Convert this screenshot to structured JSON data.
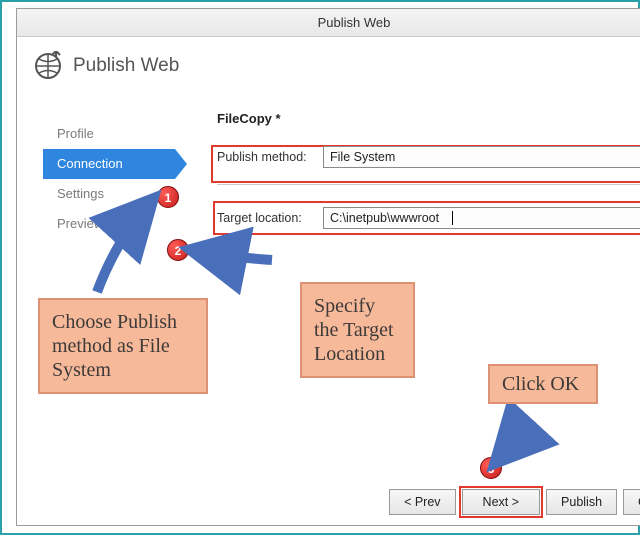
{
  "titlebar": {
    "title": "Publish Web",
    "help": "?"
  },
  "header": {
    "title": "Publish Web"
  },
  "sidebar": {
    "steps": [
      "Profile",
      "Connection",
      "Settings",
      "Preview"
    ],
    "active_index": 1
  },
  "main": {
    "title": "FileCopy *",
    "publish_method": {
      "label": "Publish method:",
      "value": "File System"
    },
    "target_location": {
      "label": "Target location:",
      "value": "C:\\inetpub\\wwwroot"
    }
  },
  "buttons": {
    "prev": "< Prev",
    "next": "Next >",
    "publish": "Publish",
    "close": "Close"
  },
  "annotations": {
    "num1": "1",
    "num2": "2",
    "num3": "3",
    "note1": "Choose Publish method as File System",
    "note2": "Specify the Target Location",
    "note3": "Click OK"
  },
  "colors": {
    "accent": "#2e86de",
    "callout_red": "#e2392f",
    "note_bg": "#f6b99a",
    "note_border": "#dd9274"
  }
}
